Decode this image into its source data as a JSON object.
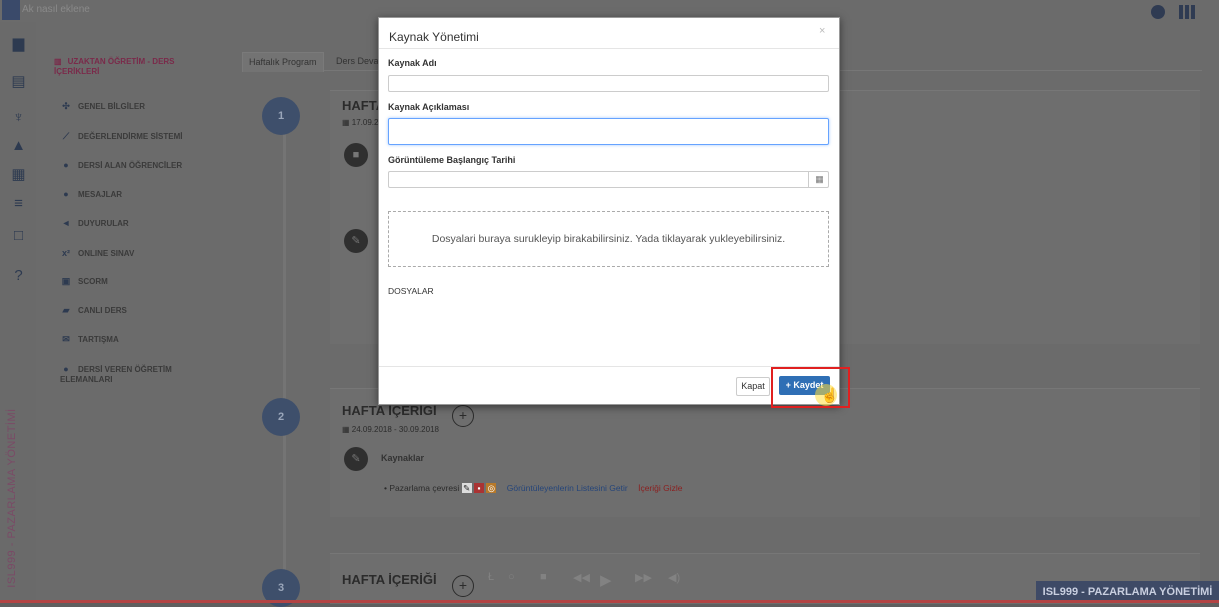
{
  "topbar": {
    "text": "Ak nasıl eklene"
  },
  "icons_left": [
    "dashboard-icon",
    "document-icon",
    "trophy-icon",
    "graduation-cap-icon",
    "calendar-icon",
    "list-icon",
    "calendar-outline-icon",
    "help-icon"
  ],
  "vertical_title": "ISL999 - PAZARLAMA YÖNETİMİ",
  "course_menu": {
    "header": "UZAKTAN ÖĞRETİM - DERS İÇERİKLERİ",
    "items": [
      {
        "label": "GENEL BİLGİLER",
        "icon": "puzzle-icon"
      },
      {
        "label": "DEĞERLENDİRME SİSTEMİ",
        "icon": "chart-line-icon"
      },
      {
        "label": "DERSİ ALAN ÖĞRENCİLER",
        "icon": "users-icon"
      },
      {
        "label": "MESAJLAR",
        "icon": "comments-icon"
      },
      {
        "label": "DUYURULAR",
        "icon": "bullhorn-icon"
      },
      {
        "label": "ONLINE SINAV",
        "icon": "superscript-icon"
      },
      {
        "label": "SCORM",
        "icon": "file-icon"
      },
      {
        "label": "CANLI DERS",
        "icon": "book-icon"
      },
      {
        "label": "TARTIŞMA",
        "icon": "envelope-icon"
      },
      {
        "label": "DERSİ VEREN ÖĞRETİM ELEMANLARI",
        "icon": "group-icon"
      }
    ]
  },
  "tabs": [
    "Haftalık Program",
    "Ders Deva"
  ],
  "weeks": [
    {
      "num": "1",
      "title": "HAFTA",
      "date": "17.09.2"
    },
    {
      "num": "2",
      "title": "HAFTA İÇERİĞİ",
      "date": "24.09.2018 - 30.09.2018",
      "resources_label": "Kaynaklar",
      "item": "Pazarlama çevresi",
      "link1": "Görüntüleyenlerin Listesini Getir",
      "link2": "İçeriği Gizle"
    },
    {
      "num": "3",
      "title": "HAFTA İÇERİĞİ"
    }
  ],
  "course_badge": "ISL999 - PAZARLAMA YÖNETİMİ",
  "modal": {
    "title": "Kaynak Yönetimi",
    "close": "×",
    "name_label": "Kaynak Adı",
    "name_value": "",
    "desc_label": "Kaynak Açıklaması",
    "desc_value": "",
    "date_label": "Görüntüleme Başlangıç Tarihi",
    "date_value": "",
    "dropzone_text": "Dosyalari buraya surukleyip birakabilirsiniz. Yada tiklayarak yukleyebilirsiniz.",
    "files_label": "DOSYALAR",
    "btn_close": "Kapat",
    "btn_save": "+ Kaydet"
  },
  "colors": {
    "accent": "#2f6fb5",
    "highlight": "#e02020",
    "week_circle": "#3e4f6b",
    "title_maroon": "#7a2a4a"
  }
}
